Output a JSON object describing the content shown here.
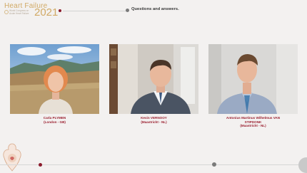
{
  "brand": {
    "title": "Heart Failure",
    "year": "2021",
    "subtitle": "World Congress on Acute Heart Failure"
  },
  "session": {
    "title": "Questions and answers."
  },
  "participants": [
    {
      "name": "Carla PLYMEN",
      "location": "(London - GB)"
    },
    {
      "name": "Kevin VERNOOY",
      "location": "(Maastricht - NL)"
    },
    {
      "name_line1": "Antonius Martinus Wilhelmus VAN",
      "name_line2": "STIPDONK",
      "location": "(Maastricht - NL)"
    }
  ],
  "colors": {
    "accent": "#8b1b2c",
    "brand_gold": "#d1aa66",
    "background": "#f3f1f0"
  }
}
